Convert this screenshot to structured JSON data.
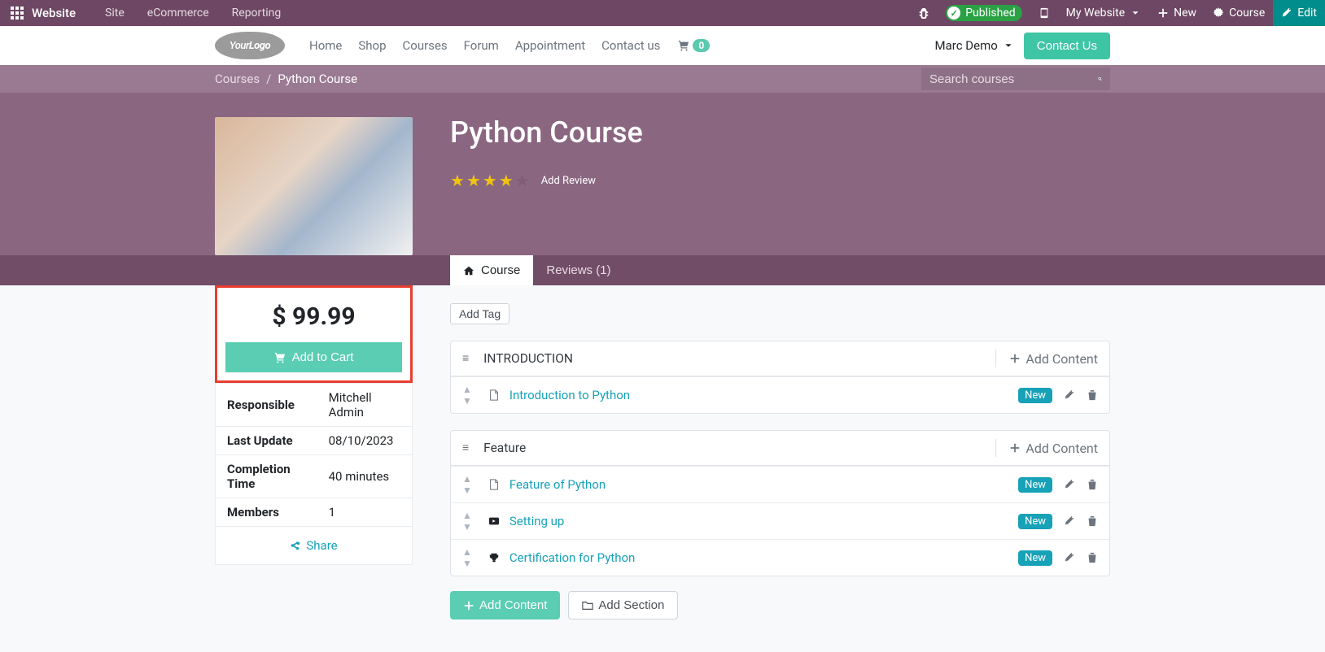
{
  "admin": {
    "brand": "Website",
    "links": [
      "Site",
      "eCommerce",
      "Reporting"
    ],
    "published": "Published",
    "my_website": "My Website",
    "new": "New",
    "course": "Course",
    "edit": "Edit"
  },
  "nav": {
    "links": [
      "Home",
      "Shop",
      "Courses",
      "Forum",
      "Appointment",
      "Contact us"
    ],
    "cart_count": "0",
    "user": "Marc Demo",
    "contact_btn": "Contact Us"
  },
  "breadcrumb": {
    "parent": "Courses",
    "current": "Python Course",
    "search_placeholder": "Search courses"
  },
  "hero": {
    "title": "Python Course",
    "add_review": "Add Review",
    "rating": 4
  },
  "tabs": {
    "course": "Course",
    "reviews": "Reviews (1)"
  },
  "sidebar": {
    "price": "$ 99.99",
    "add_to_cart": "Add to Cart",
    "fields": {
      "responsible_label": "Responsible",
      "responsible_value": "Mitchell Admin",
      "last_update_label": "Last Update",
      "last_update_value": "08/10/2023",
      "completion_label": "Completion Time",
      "completion_value": "40 minutes",
      "members_label": "Members",
      "members_value": "1"
    },
    "share": "Share"
  },
  "content": {
    "add_tag": "Add Tag",
    "add_content": "Add Content",
    "add_content_btn": "Add Content",
    "add_section": "Add Section",
    "new_pill": "New",
    "sections": [
      {
        "title": "INTRODUCTION",
        "rows": [
          {
            "icon": "doc",
            "title": "Introduction to Python"
          }
        ]
      },
      {
        "title": "Feature",
        "rows": [
          {
            "icon": "doc",
            "title": "Feature of Python"
          },
          {
            "icon": "video",
            "title": "Setting up"
          },
          {
            "icon": "trophy",
            "title": "Certification for Python"
          }
        ]
      }
    ]
  }
}
